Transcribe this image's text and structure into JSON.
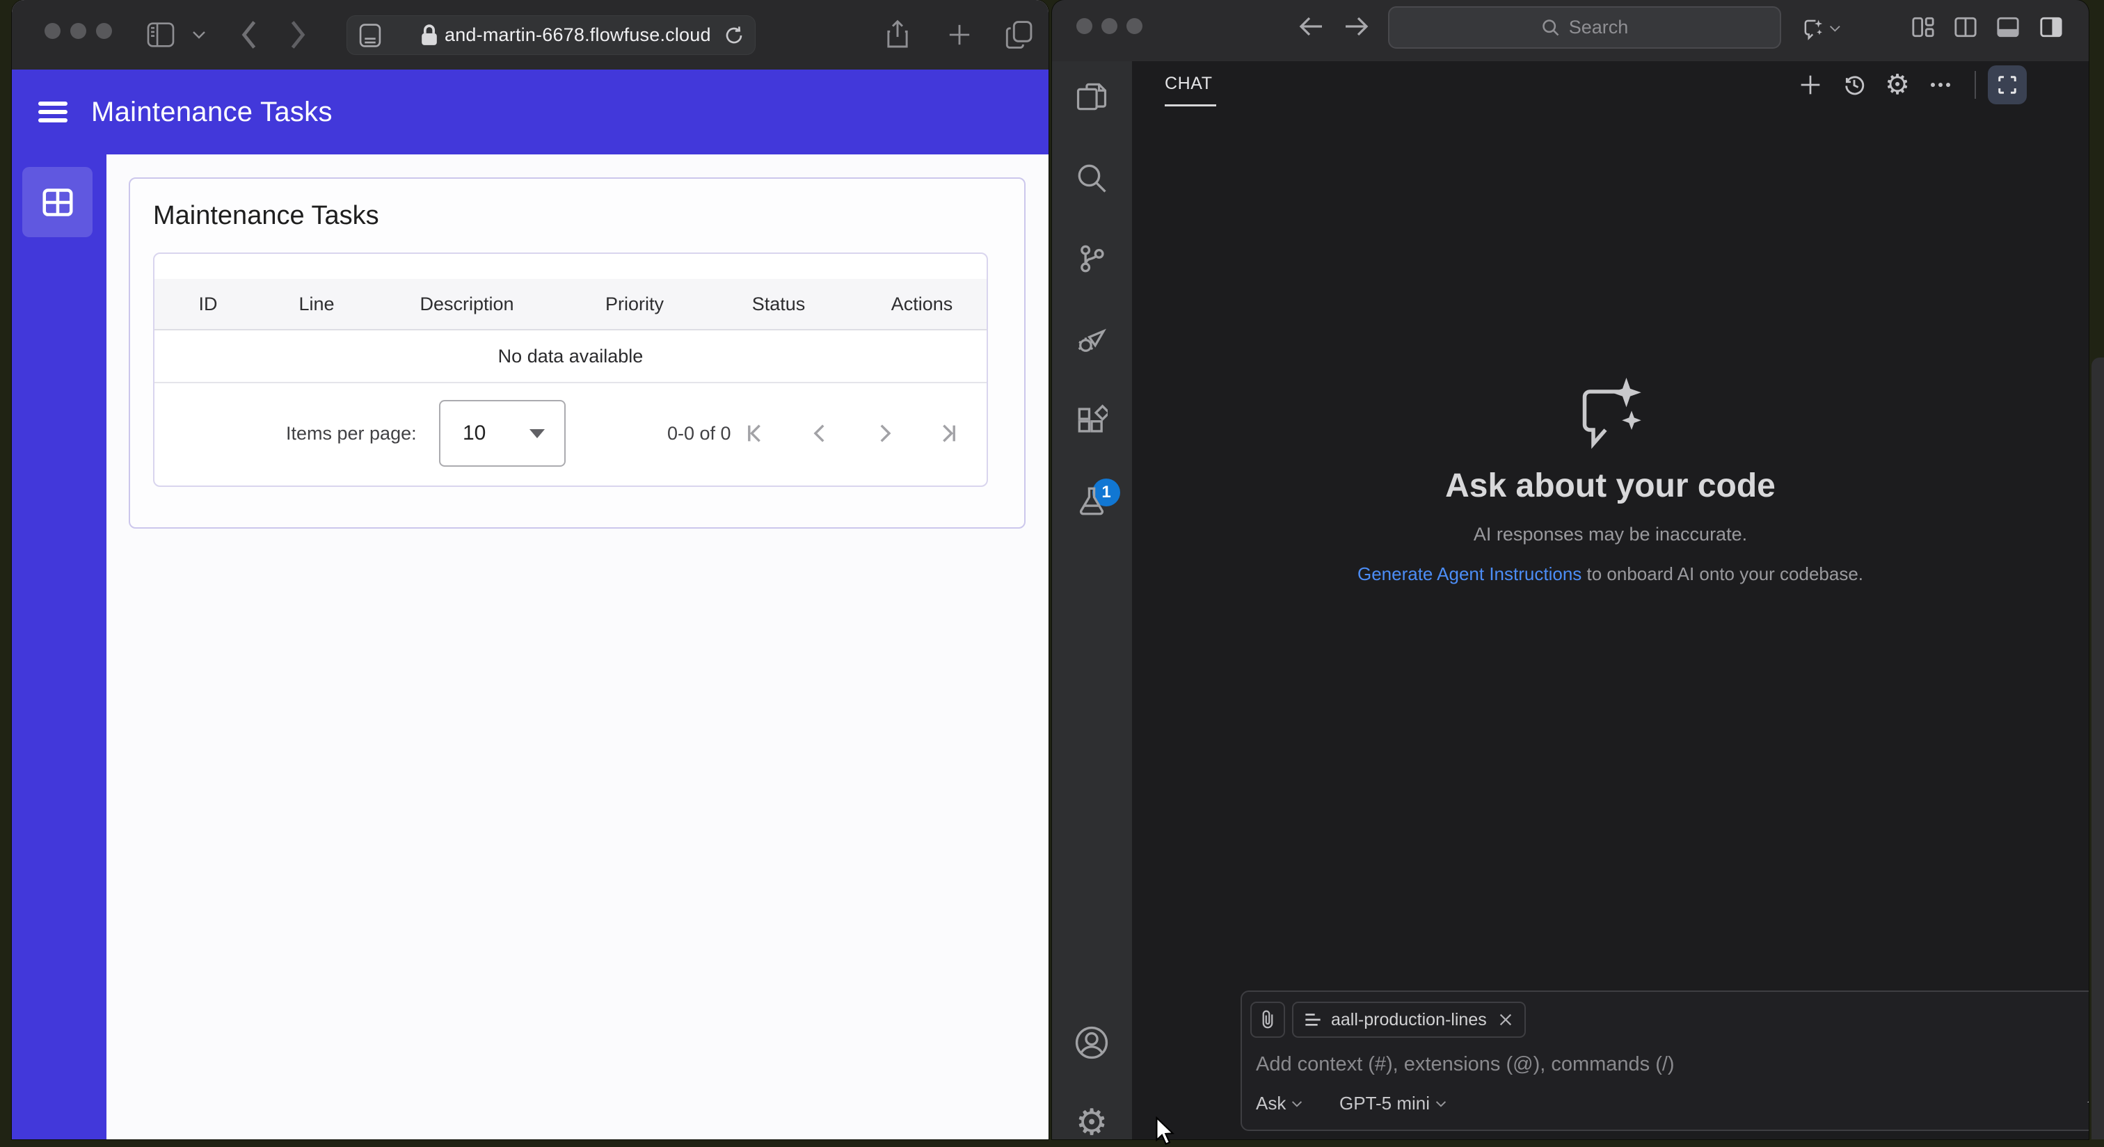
{
  "browser": {
    "url": "and-martin-6678.flowfuse.cloud"
  },
  "webapp": {
    "colors": {
      "primary": "#4238da",
      "page_bg": "#fbfbfd",
      "card_border": "#ccc7ec"
    },
    "header": {
      "title": "Maintenance Tasks"
    },
    "card": {
      "title": "Maintenance Tasks"
    },
    "table": {
      "columns": [
        "ID",
        "Line",
        "Description",
        "Priority",
        "Status",
        "Actions"
      ],
      "empty_text": "No data available"
    },
    "pagination": {
      "items_per_page_label": "Items per page:",
      "page_size": "10",
      "range_text": "0-0 of 0"
    }
  },
  "vscode": {
    "titlebar": {
      "search_placeholder": "Search"
    },
    "activity_bar": {
      "extensions_badge": "1",
      "badge_color": "#1177d3"
    },
    "chat": {
      "tab_label": "CHAT",
      "empty": {
        "title": "Ask about your code",
        "subtitle": "AI responses may be inaccurate.",
        "link_label": "Generate Agent Instructions",
        "link_suffix": " to onboard AI onto your codebase.",
        "link_color": "#4c8df6"
      },
      "input": {
        "context_chip_label": "aall-production-lines",
        "placeholder": "Add context (#), extensions (@), commands (/)",
        "mode_label": "Ask",
        "model_label": "GPT-5 mini"
      }
    }
  }
}
